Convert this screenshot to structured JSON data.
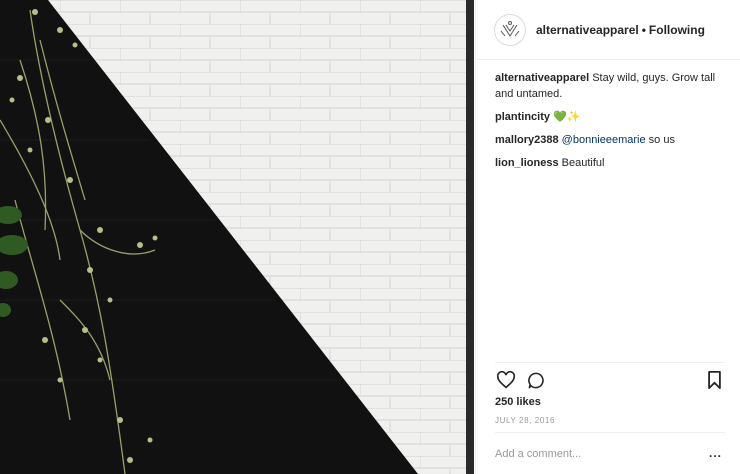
{
  "post": {
    "author": "alternativeapparel",
    "follow_status": "Following",
    "separator": "•",
    "avatar_icon": "brand-logo-icon"
  },
  "comments": [
    {
      "user": "alternativeapparel",
      "text": " Stay wild, guys. Grow tall and untamed."
    },
    {
      "user": "plantincity",
      "emoji": "💚",
      "emoji2": "✨"
    },
    {
      "user": "mallory2388",
      "mention": "@bonnieeemarie",
      "text": " so us"
    },
    {
      "user": "lion_lioness",
      "text": " Beautiful"
    }
  ],
  "actions": {
    "like_icon": "heart-outline-icon",
    "comment_icon": "speech-bubble-icon",
    "save_icon": "bookmark-icon"
  },
  "likes": "250 likes",
  "date": "JULY 28, 2016",
  "add_comment": {
    "placeholder": "Add a comment..."
  },
  "more_label": "...",
  "colors": {
    "photo_dark": "#111111",
    "photo_light": "#f0f0ef",
    "mention": "#003569",
    "muted": "#999999",
    "divider": "#efefef"
  }
}
